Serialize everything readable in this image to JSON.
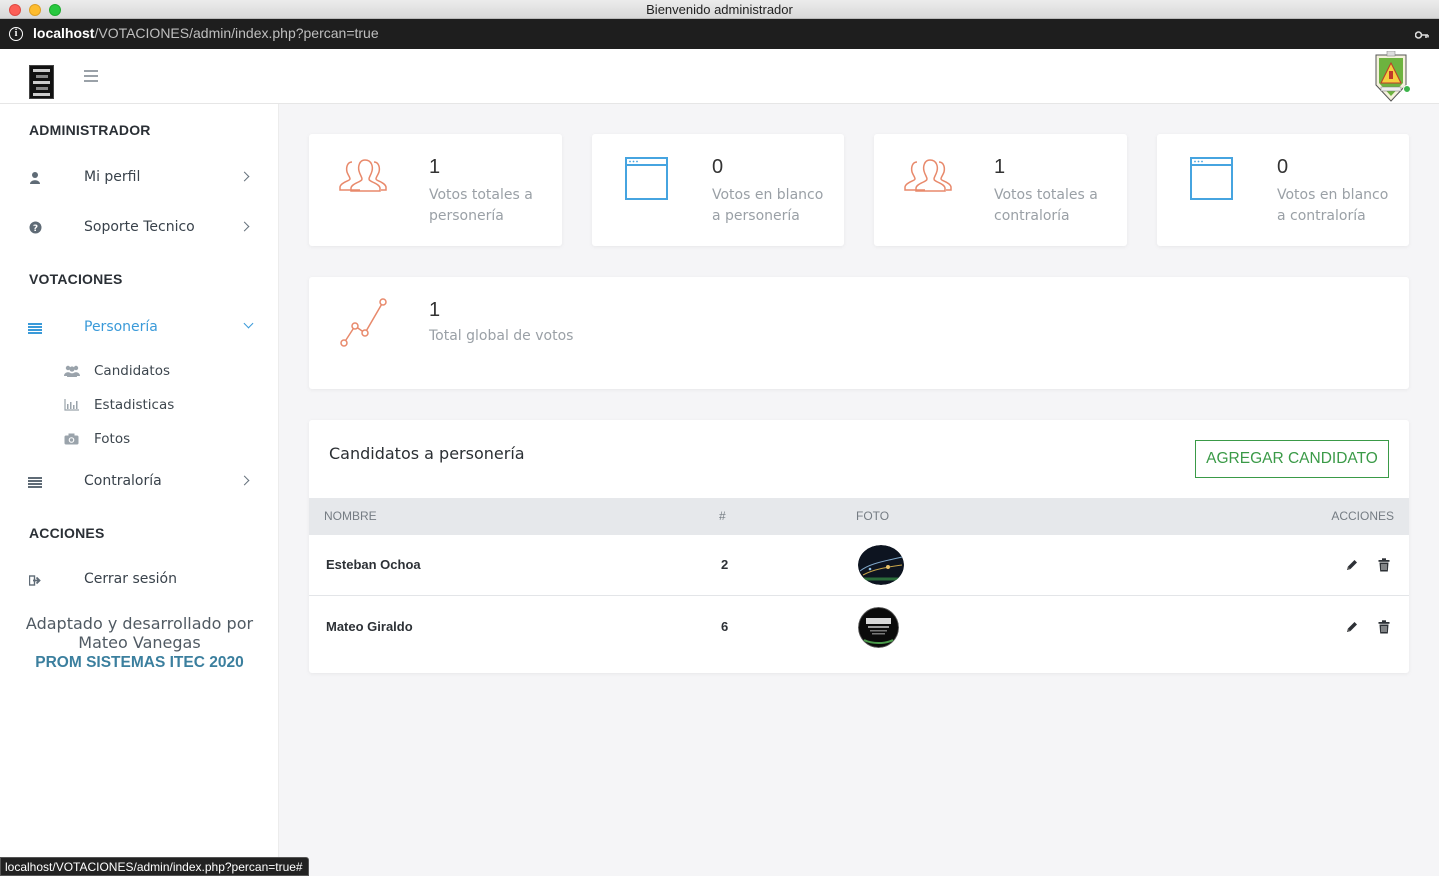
{
  "window": {
    "title": "Bienvenido administrador"
  },
  "browser": {
    "url_host": "localhost",
    "url_path": "/VOTACIONES/admin/index.php?percan=true",
    "status_url": "localhost/VOTACIONES/admin/index.php?percan=true#"
  },
  "sidebar": {
    "heading_admin": "ADMINISTRADOR",
    "mi_perfil": "Mi perfil",
    "soporte": "Soporte Tecnico",
    "heading_votaciones": "VOTACIONES",
    "personeria": "Personería",
    "sub_candidatos": "Candidatos",
    "sub_estadisticas": "Estadisticas",
    "sub_fotos": "Fotos",
    "contraloria": "Contraloría",
    "heading_acciones": "ACCIONES",
    "cerrar_sesion": "Cerrar sesión",
    "credits_line1": "Adaptado y desarrollado por",
    "credits_line2": "Mateo Vanegas",
    "credits_line3": "PROM SISTEMAS ITEC 2020"
  },
  "stats": [
    {
      "value": "1",
      "label": "Votos totales a personería",
      "icon": "users-icon",
      "color": "#e8896b"
    },
    {
      "value": "0",
      "label": "Votos en blanco a personería",
      "icon": "window-icon",
      "color": "#46a4e0"
    },
    {
      "value": "1",
      "label": "Votos totales a contraloría",
      "icon": "users-icon",
      "color": "#e8896b"
    },
    {
      "value": "0",
      "label": "Votos en blanco a contraloría",
      "icon": "window-icon",
      "color": "#46a4e0"
    }
  ],
  "global": {
    "value": "1",
    "label": "Total global de votos",
    "icon": "line-chart-icon"
  },
  "table": {
    "title": "Candidatos a personería",
    "add_button": "AGREGAR CANDIDATO",
    "columns": {
      "nombre": "NOMBRE",
      "numero": "#",
      "foto": "FOTO",
      "acciones": "ACCIONES"
    },
    "rows": [
      {
        "nombre": "Esteban Ochoa",
        "numero": "2"
      },
      {
        "nombre": "Mateo Giraldo",
        "numero": "6"
      }
    ]
  },
  "colors": {
    "accent_blue": "#3a9ad9",
    "accent_green": "#3a9a47",
    "accent_orange": "#e8896b"
  }
}
